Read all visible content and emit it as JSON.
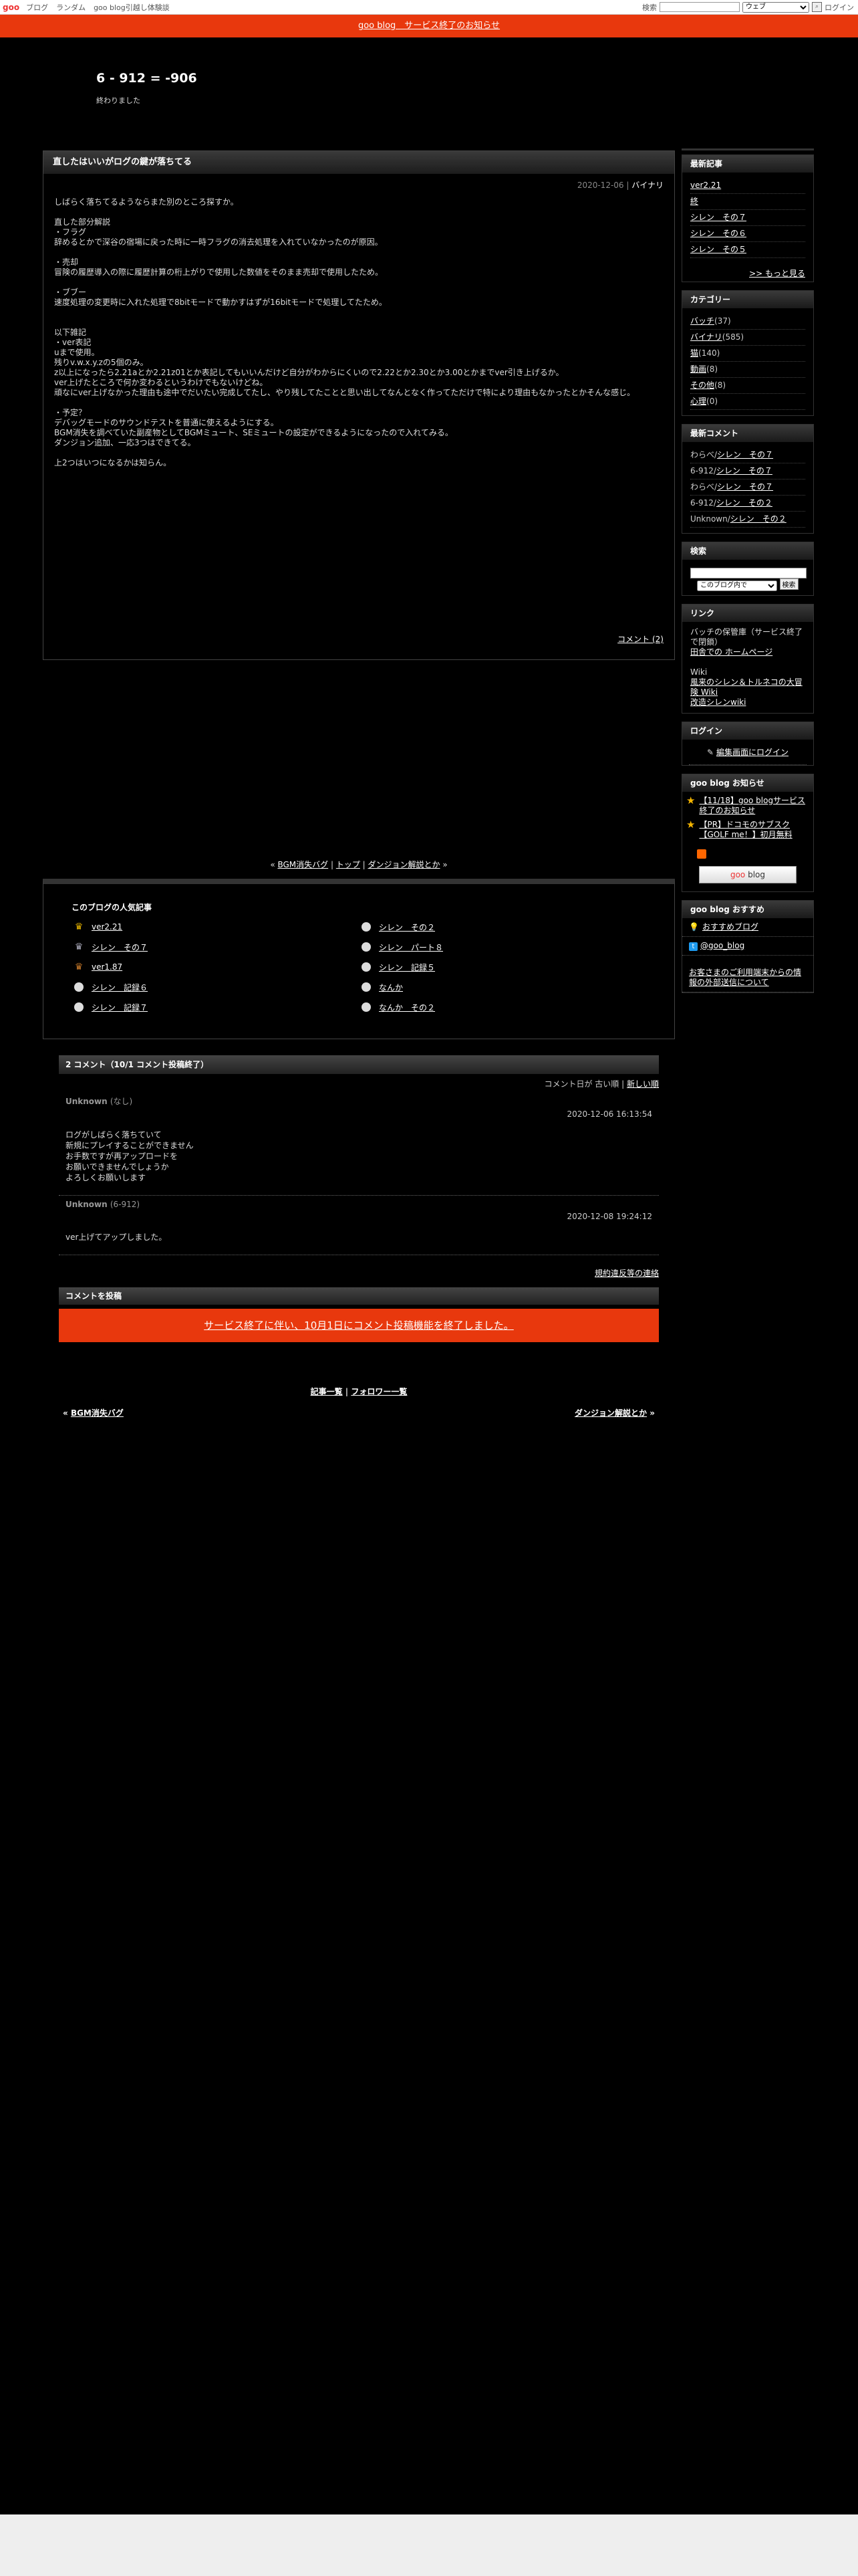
{
  "toolbar": {
    "logo": "goo",
    "links": [
      "ブログ",
      "ランダム",
      "goo blog引越し体験談"
    ],
    "search_label": "検索",
    "search_scope": "ウェブ",
    "login": "ログイン"
  },
  "notice": "goo blog　サービス終了のお知らせ",
  "blog": {
    "title": "6 - 912 = -906",
    "description": "終わりました"
  },
  "article": {
    "title": "直したはいいがログの鍵が落ちてる",
    "date": "2020-12-06",
    "category": "バイナリ",
    "body": [
      "しばらく落ちてるようならまた別のところ探すか。",
      "",
      "直した部分解説",
      "・フラグ",
      "辞めるとかで深谷の宿場に戻った時に一時フラグの消去処理を入れていなかったのが原因。",
      "",
      "・売却",
      "冒険の履歴導入の際に履歴計算の桁上がりで使用した数値をそのまま売却で使用したため。",
      "",
      "・ブブー",
      "速度処理の変更時に入れた処理で8bitモードで動かすはずが16bitモードで処理してたため。",
      "",
      "",
      "以下雑記",
      "・ver表記",
      "uまで使用。",
      "残りv.w.x.y.zの5個のみ。",
      "z以上になったら2.21aとか2.21z01とか表記してもいいんだけど自分がわからにくいので2.22とか2.30とか3.00とかまでver引き上げるか。",
      "ver上げたところで何か変わるというわけでもないけどね。",
      "頑なにver上げなかった理由も途中でだいたい完成してたし、やり残してたことと思い出してなんとなく作ってただけで特により理由もなかったとかそんな感じ。",
      "",
      "・予定？",
      "デバッグモードのサウンドテストを普通に使えるようにする。",
      "BGM消失を調べていた副産物としてBGMミュート、SEミュートの設定ができるようになったので入れてみる。",
      "ダンジョン追加、一応3つはできてる。",
      "",
      "上2つはいつになるかは知らん。"
    ],
    "comment_link": "コメント (2)"
  },
  "pager": {
    "prev": "BGM消失バグ",
    "top": "トップ",
    "next": "ダンジョン解説とか"
  },
  "popular": {
    "title": "このブログの人気記事",
    "items": [
      "ver2.21",
      "シレン　その２",
      "シレン　その７",
      "シレン　パート８",
      "ver1.87",
      "シレン　記録５",
      "シレン　記録６",
      "なんか",
      "シレン　記録７",
      "なんか　その２"
    ]
  },
  "comments": {
    "header": "2 コメント（10/1 コメント投稿終了）",
    "sort_label": "コメント日が",
    "sort_old": "古い順",
    "sort_new": "新しい順",
    "items": [
      {
        "name": "Unknown",
        "author": "(なし)",
        "date": "2020-12-06 16:13:54",
        "lines": [
          "",
          "ログがしばらく落ちていて",
          "新規にプレイすることができません",
          "お手数ですが再アップロードを",
          "お願いできませんでしょうか",
          "よろしくお願いします"
        ]
      },
      {
        "name": "Unknown",
        "author": "(6-912)",
        "date": "2020-12-08 19:24:12",
        "lines": [
          "",
          "ver上げてアップしました。"
        ]
      }
    ],
    "ng_link": "規約違反等の連絡",
    "post_header": "コメントを投稿",
    "post_notice": "サービス終了に伴い、10月1日にコメント投稿機能を終了しました。"
  },
  "bottom": {
    "list": "記事一覧",
    "sep": "|",
    "followers": "フォロワー一覧",
    "prev": "BGM消失バグ",
    "next": "ダンジョン解説とか"
  },
  "sidebar": {
    "recent": {
      "title": "最新記事",
      "items": [
        "ver2.21",
        "終",
        "シレン　その７",
        "シレン　その６",
        "シレン　その５"
      ],
      "more": ">> もっと見る"
    },
    "category": {
      "title": "カテゴリー",
      "items": [
        {
          "name": "バッチ",
          "count": "(37)"
        },
        {
          "name": "バイナリ",
          "count": "(585)"
        },
        {
          "name": "猫",
          "count": "(140)"
        },
        {
          "name": "動画",
          "count": "(8)"
        },
        {
          "name": "その他",
          "count": "(8)"
        },
        {
          "name": "心理",
          "count": "(0)"
        }
      ]
    },
    "comments": {
      "title": "最新コメント",
      "items": [
        {
          "who": "わらべ/",
          "what": "シレン　その７"
        },
        {
          "who": "6-912/",
          "what": "シレン　その７"
        },
        {
          "who": "わらべ/",
          "what": "シレン　その７"
        },
        {
          "who": "6-912/",
          "what": "シレン　その２"
        },
        {
          "who": "Unknown/",
          "what": "シレン　その２"
        }
      ]
    },
    "search": {
      "title": "検索",
      "scope": "このブログ内で",
      "button": "検索"
    },
    "links": {
      "title": "リンク",
      "text1": "バッチの保管庫（サービス終了で閉鎖）",
      "link1": "田舎での ホームページ",
      "text2": "Wiki",
      "link2": "風来のシレン＆トルネコの大冒険 Wiki",
      "link3": "改造シレンwiki"
    },
    "login": {
      "title": "ログイン",
      "link": "編集画面にログイン"
    },
    "info": {
      "title": "goo blog お知らせ",
      "items": [
        "【11/18】goo blogサービス終了のお知らせ",
        "【PR】ドコモのサブスク【GOLF me！】初月無料"
      ],
      "button_goo": "goo",
      "button_blog": " blog"
    },
    "recommend": {
      "title": "goo blog おすすめ",
      "item": "おすすめブログ",
      "twitter": "@goo_blog",
      "notice": "お客さまのご利用端末からの情報の外部送信について"
    }
  }
}
